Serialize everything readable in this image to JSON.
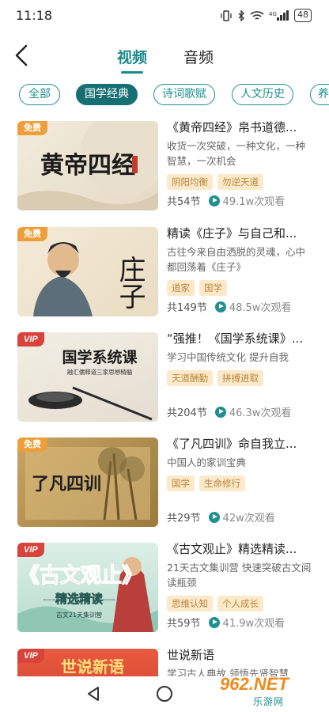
{
  "status": {
    "time": "11:18",
    "battery": "48",
    "signal": "4G"
  },
  "header": {
    "tabs": [
      "视频",
      "音频"
    ],
    "active_tab": "视频"
  },
  "categories": [
    "全部",
    "国学经典",
    "诗词歌赋",
    "人文历史",
    "养"
  ],
  "active_category": "国学经典",
  "courses": [
    {
      "badge": "免费",
      "thumb_text": "黄帝四经",
      "title": "《黄帝四经》帛书道德...",
      "desc": "收货一次突破，一种文化，一种智慧，一次机会",
      "tags": [
        "阴阳均衡",
        "勿逆天道"
      ],
      "lessons": "共54节",
      "views": "49.1w次观看"
    },
    {
      "badge": "免费",
      "thumb_text": "庄子",
      "title": "精读《庄子》与自己和...",
      "desc": "古往今来自由洒脱的灵魂，心中都回荡着《庄子》",
      "tags": [
        "道家",
        "国学"
      ],
      "lessons": "共149节",
      "views": "48.5w次观看"
    },
    {
      "badge": "VIP",
      "thumb_text": "国学系统课",
      "thumb_sub": "融汇儒释道三家思想精髓",
      "title": "“强推！《国学系统课》...",
      "desc": "学习中国传统文化 提升自我",
      "tags": [
        "天道酬勤",
        "拼搏进取"
      ],
      "lessons": "共204节",
      "views": "46.3w次观看"
    },
    {
      "badge": "免费",
      "thumb_text": "了凡四训",
      "title": "《了凡四训》命自我立...",
      "desc": "中国人的家训宝典",
      "tags": [
        "国学",
        "生命修行"
      ],
      "lessons": "共29节",
      "views": "42w次观看"
    },
    {
      "badge": "VIP",
      "thumb_text": "《古文观止》",
      "thumb_sub": "—精选精读—",
      "thumb_sub2": "古文21天集训营",
      "title": "《古文观止》精选精读...",
      "desc": "21天古文集训营 快速突破古文阅读瓶颈",
      "tags": [
        "思维认知",
        "个人成长"
      ],
      "lessons": "共59节",
      "views": "41.9w次观看"
    },
    {
      "badge": "VIP",
      "thumb_text": "世说新语",
      "title": "世说新语",
      "desc": "学习古人典故 领悟先贤智慧",
      "tags": [],
      "lessons": "",
      "views": ""
    }
  ],
  "watermark": {
    "main": "962.NET",
    "sub": "乐游网"
  },
  "colors": {
    "accent": "#1b8a8a",
    "chip_active": "#156f73",
    "tag_bg": "#fbe9c9",
    "tag_text": "#b8843c",
    "free_badge": "#ee9f3c",
    "vip_badge": "#d8433b"
  }
}
